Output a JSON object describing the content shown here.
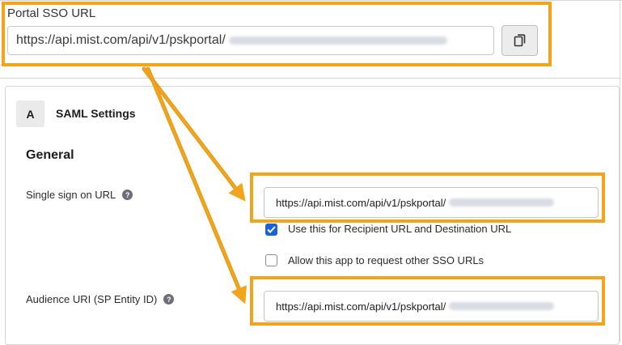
{
  "portal": {
    "title": "Portal SSO URL",
    "url": "https://api.mist.com/api/v1/pskportal/",
    "copy_icon": "copy-icon"
  },
  "saml": {
    "badge": "A",
    "title": "SAML Settings",
    "general_heading": "General",
    "sso_url": {
      "label": "Single sign on URL",
      "help_icon": "question-circle-icon",
      "value": "https://api.mist.com/api/v1/pskportal/"
    },
    "recipient_checkbox": {
      "label": "Use this for Recipient URL and Destination URL",
      "checked": true
    },
    "other_sso_checkbox": {
      "label": "Allow this app to request other SSO URLs",
      "checked": false
    },
    "audience_uri": {
      "label": "Audience URI (SP Entity ID)",
      "help_icon": "question-circle-icon",
      "value": "https://api.mist.com/api/v1/pskportal/"
    }
  },
  "colors": {
    "highlight": "#f2a41a",
    "checkbox_checked": "#1662dd"
  }
}
